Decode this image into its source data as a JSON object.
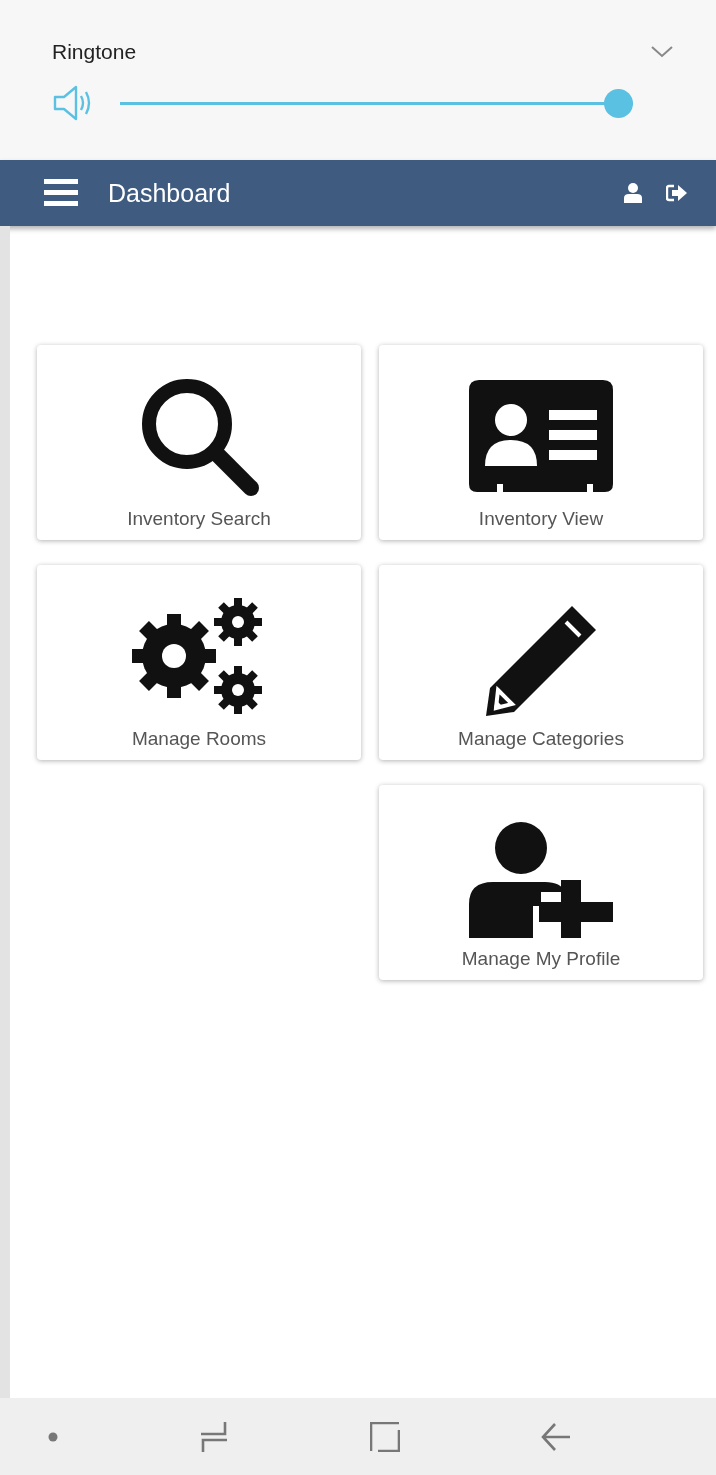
{
  "volume_panel": {
    "title": "Ringtone",
    "level": 1.0
  },
  "app_bar": {
    "title": "Dashboard"
  },
  "tile_columns": [
    {
      "tiles": [
        {
          "kind": "search",
          "label": "Inventory Search"
        },
        {
          "kind": "gears",
          "label": "Manage Rooms"
        }
      ]
    },
    {
      "tiles": [
        {
          "kind": "id-card",
          "label": "Inventory View"
        },
        {
          "kind": "pencil",
          "label": "Manage Categories"
        },
        {
          "kind": "user-plus",
          "label": "Manage My Profile"
        }
      ]
    }
  ]
}
